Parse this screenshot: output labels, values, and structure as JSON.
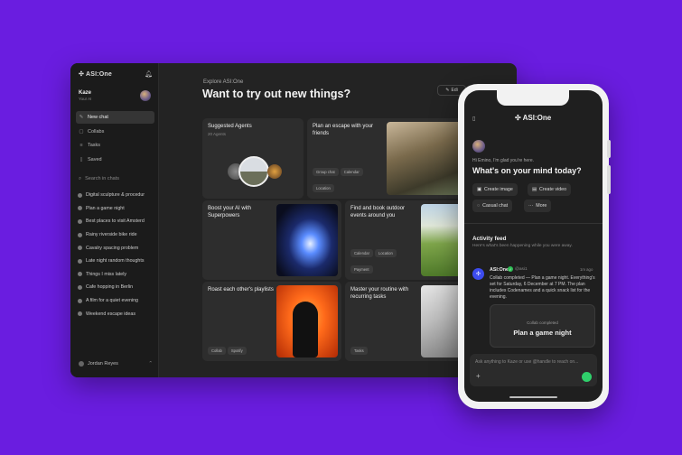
{
  "app": {
    "brand": "ASI:One",
    "user_name": "Kaze",
    "user_sub": "Your AI"
  },
  "sidebar": {
    "nav": [
      {
        "label": "New chat",
        "icon": "new-chat-icon"
      },
      {
        "label": "Collabs",
        "icon": "collabs-icon"
      },
      {
        "label": "Tasks",
        "icon": "tasks-icon"
      },
      {
        "label": "Saved",
        "icon": "bookmark-icon"
      }
    ],
    "search_placeholder": "Search in chats",
    "chats": [
      "Digital sculpture & procedur",
      "Plan a game night",
      "Best places to visit Amsterd",
      "Rainy riverside bike ride",
      "Cavalry spacing problem",
      "Late night random thoughts",
      "Things I miss lately",
      "Cafe hopping in Berlin",
      "A film for a quiet evening",
      "Weekend escape ideas"
    ],
    "footer_user": "Jordan Reyes"
  },
  "main": {
    "explore_label": "Explore ASI:One",
    "title": "Want to try out new things?",
    "edit_label": "Edi",
    "cards": [
      {
        "title": "Suggested Agents",
        "sub": "20 Agents",
        "chips": []
      },
      {
        "title": "Plan an escape with your friends",
        "chips": [
          "Group chat",
          "Calendar",
          "Location"
        ]
      },
      {
        "title": "Boost your AI with Superpowers",
        "chips": []
      },
      {
        "title": "Find and book outdoor events around you",
        "chips": [
          "Calendar",
          "Location",
          "Payment"
        ]
      },
      {
        "title": "Roast each other's playlists",
        "chips": [
          "Collab",
          "Spotify"
        ]
      },
      {
        "title": "Master your routine with recurring tasks",
        "chips": [
          "Tasks"
        ]
      }
    ]
  },
  "phone": {
    "brand": "ASI:One",
    "greeting": "Hi Emino, I'm glad you're here.",
    "title": "What's on your mind today?",
    "actions": [
      "Create image",
      "Create video",
      "Casual chat",
      "More"
    ],
    "activity_title": "Activity feed",
    "activity_sub": "Here's what's been happening while you were away.",
    "feed": {
      "name": "ASI:One",
      "handle": "@asi1",
      "time": "1m ago",
      "text": "Collab completed — Plan a game night. Everything's set for Saturday, 6 December at 7 PM. The plan includes Codenames and a quick snack list for the evening."
    },
    "collab_label": "Collab completed",
    "collab_title": "Plan a game night",
    "input_placeholder": "Ask anything to Kaze or use @handle to reach on..."
  },
  "colors": {
    "background": "#6a1de0",
    "panel": "#232323",
    "accent_green": "#2fd06b",
    "accent_blue": "#3d4cf0"
  }
}
